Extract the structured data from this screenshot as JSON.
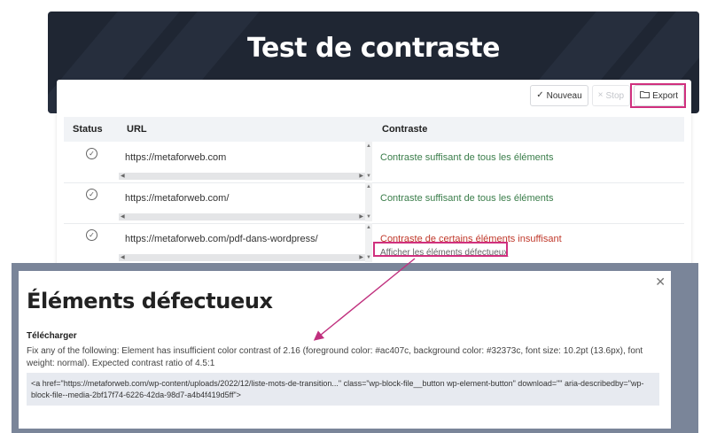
{
  "page": {
    "title": "Test de contraste"
  },
  "toolbar": {
    "nouveau_label": "Nouveau",
    "stop_label": "Stop",
    "export_label": "Export"
  },
  "table": {
    "headers": {
      "status": "Status",
      "url": "URL",
      "contrast": "Contraste"
    },
    "rows": [
      {
        "url": "https://metaforweb.com",
        "contrast": "Contraste suffisant de tous les éléments",
        "state": "ok"
      },
      {
        "url": "https://metaforweb.com/",
        "contrast": "Contraste suffisant de tous les éléments",
        "state": "ok"
      },
      {
        "url": "https://metaforweb.com/pdf-dans-wordpress/",
        "contrast": "Contraste de certains éléments insuffisant",
        "state": "bad",
        "link": "Afficher les éléments défectueux"
      }
    ]
  },
  "modal": {
    "title": "Éléments défectueux",
    "download_label": "Télécharger",
    "description": "Fix any of the following: Element has insufficient color contrast of 2.16 (foreground color: #ac407c, background color: #32373c, font size: 10.2pt (13.6px), font weight: normal). Expected contrast ratio of 4.5:1",
    "code": "<a href=\"https://metaforweb.com/wp-content/uploads/2022/12/liste-mots-de-transition...\" class=\"wp-block-file__button wp-element-button\" download=\"\" aria-describedby=\"wp-block-file--media-2bf17f74-6226-42da-98d7-a4b4f419d5ff\">",
    "close_icon": "close-icon"
  },
  "colors": {
    "banner": "#1f2633",
    "highlight": "#d0307e",
    "ok_text": "#3a7d4a",
    "bad_text": "#c0392b"
  }
}
